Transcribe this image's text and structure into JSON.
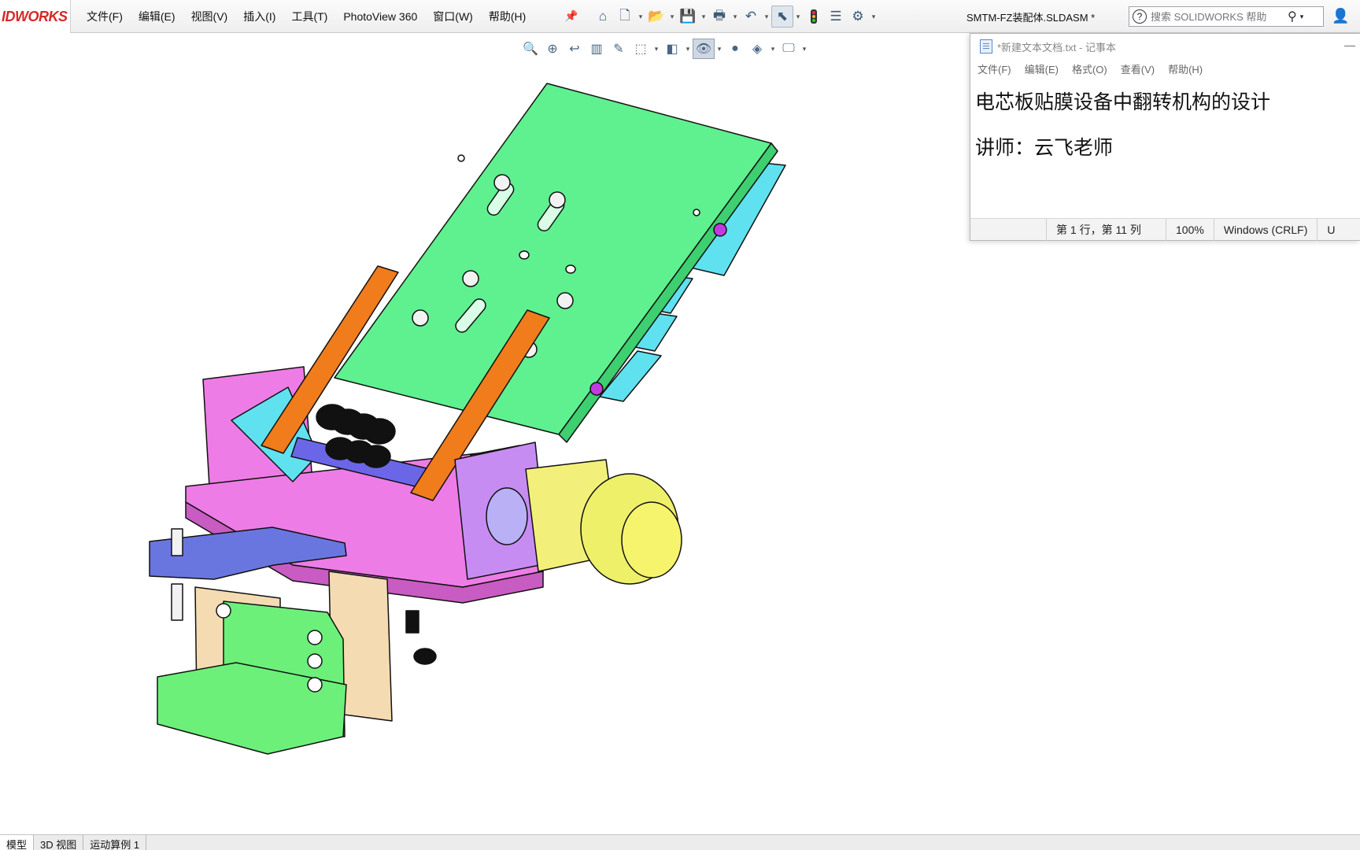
{
  "app": {
    "logo_text": "IDWORKS",
    "doc_title": "SMTM-FZ装配体.SLDASM *",
    "menus": [
      "文件(F)",
      "编辑(E)",
      "视图(V)",
      "插入(I)",
      "工具(T)",
      "PhotoView 360",
      "窗口(W)",
      "帮助(H)"
    ],
    "search_placeholder": "搜索 SOLIDWORKS 帮助"
  },
  "toolbar_icons": [
    "home-icon",
    "new-doc-icon",
    "open-icon",
    "save-icon",
    "print-icon",
    "undo-icon",
    "select-icon",
    "rebuild-icon",
    "file-properties-icon",
    "options-icon"
  ],
  "view_icons": [
    "zoom-to-fit-icon",
    "zoom-area-icon",
    "previous-view-icon",
    "section-view-icon",
    "dynamic-annotation-icon",
    "view-orientation-icon",
    "display-style-icon",
    "hide-show-icon",
    "edit-appearance-icon",
    "apply-scene-icon",
    "view-settings-icon"
  ],
  "notepad": {
    "title": "*新建文本文档.txt - 记事本",
    "menus": [
      "文件(F)",
      "编辑(E)",
      "格式(O)",
      "查看(V)",
      "帮助(H)"
    ],
    "line1": "电芯板贴膜设备中翻转机构的设计",
    "line2": "讲师：云飞老师",
    "status_position": "第 1 行，第 11 列",
    "status_zoom": "100%",
    "status_eol": "Windows (CRLF)",
    "status_enc": "U"
  },
  "bottom_tabs": [
    "模型",
    "3D 视图",
    "运动算例 1"
  ]
}
